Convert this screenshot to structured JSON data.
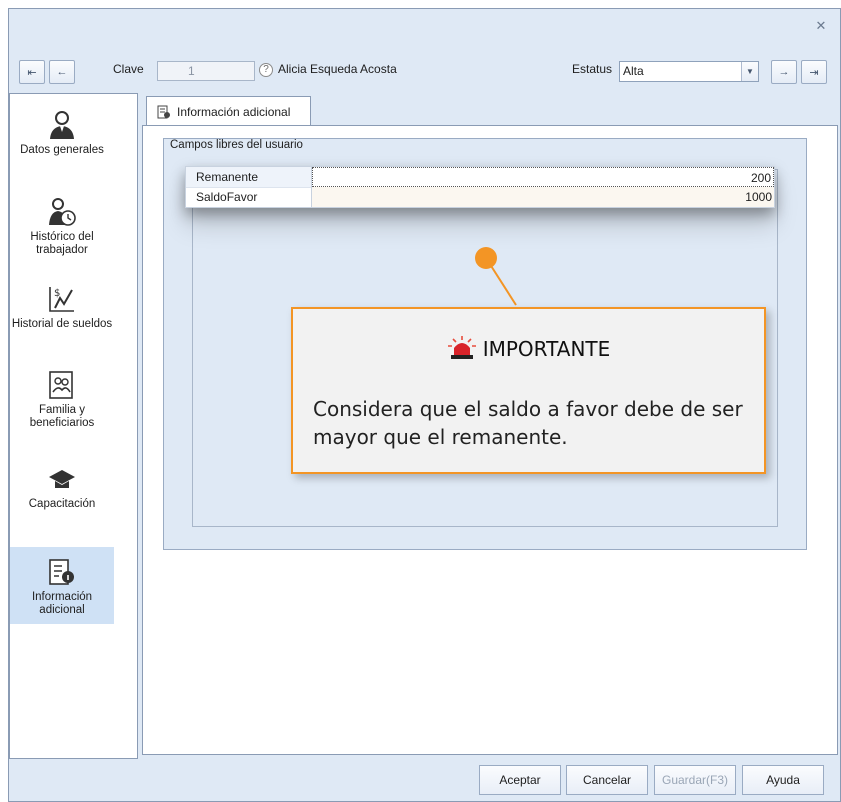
{
  "window": {
    "close_glyph": "✕"
  },
  "toolbar": {
    "first_glyph": "⇤",
    "prev_glyph": "←",
    "next_glyph": "→",
    "last_glyph": "⇥",
    "clave_label": "Clave",
    "clave_value": "1",
    "help_glyph": "?",
    "employee_name": "Alicia Esqueda Acosta",
    "estatus_label": "Estatus",
    "estatus_value": "Alta",
    "dropdown_glyph": "▼"
  },
  "sidebar": {
    "items": [
      {
        "label": "Datos generales",
        "icon": "person-icon"
      },
      {
        "label": "Histórico del trabajador",
        "icon": "person-clock-icon"
      },
      {
        "label": "Historial de sueldos",
        "icon": "salary-chart-icon"
      },
      {
        "label": "Familia y beneficiarios",
        "icon": "family-icon"
      },
      {
        "label": "Capacitación",
        "icon": "graduation-cap-icon"
      },
      {
        "label": "Información adicional",
        "icon": "info-document-icon",
        "active": true
      }
    ]
  },
  "tab": {
    "label": "Información adicional"
  },
  "group": {
    "title": "Campos libres del usuario"
  },
  "grid": {
    "rows": [
      {
        "name": "Remanente",
        "value": "200"
      },
      {
        "name": "SaldoFavor",
        "value": "1000"
      }
    ]
  },
  "callout": {
    "title": "IMPORTANTE",
    "text": "Considera que el saldo a favor debe de ser mayor que el remanente.",
    "accent_color": "#f39525"
  },
  "buttons": {
    "aceptar": "Aceptar",
    "cancelar": "Cancelar",
    "guardar": "Guardar(F3)",
    "ayuda": "Ayuda"
  }
}
